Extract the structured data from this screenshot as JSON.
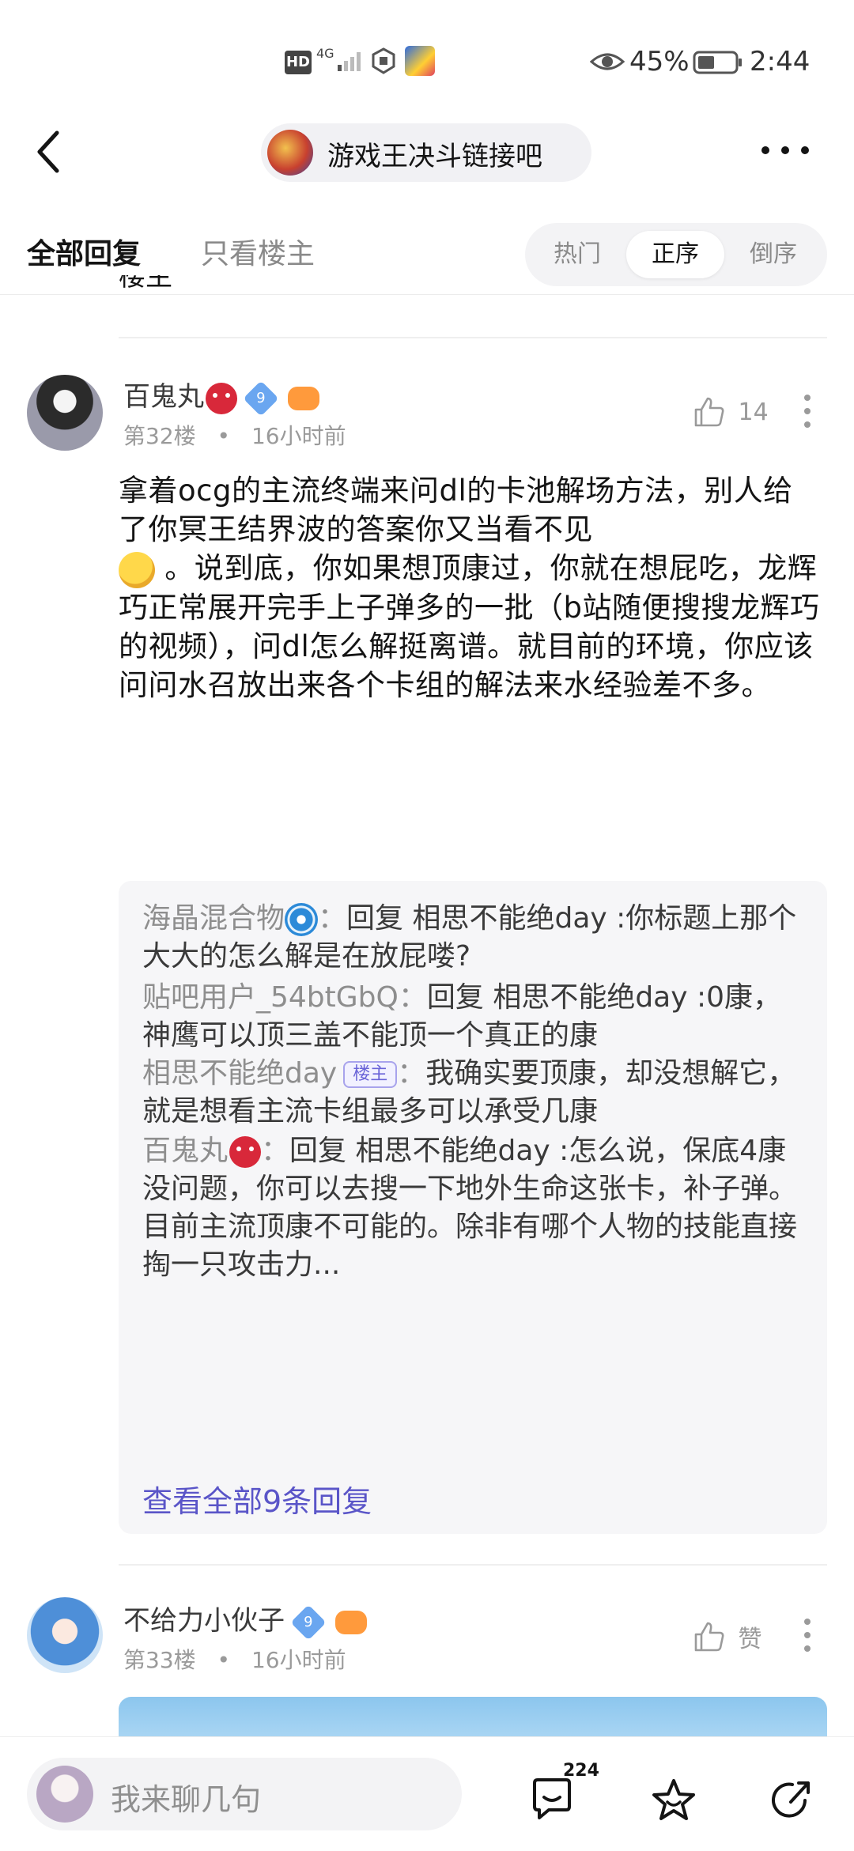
{
  "status_bar": {
    "hd": "HD",
    "network": "4G",
    "battery_pct": "45%",
    "time": "2:44"
  },
  "header": {
    "forum_name": "游戏王决斗链接吧"
  },
  "tabs": {
    "all": "全部回复",
    "owner_only": "只看楼主"
  },
  "sort": {
    "hot": "热门",
    "asc": "正序",
    "desc": "倒序",
    "selected": "正序"
  },
  "prev_tail": "楼主",
  "post32": {
    "username": "百鬼丸",
    "level": "9",
    "floor": "第32楼",
    "dot": "•",
    "time": "16小时前",
    "likes": "14",
    "body_a": "拿着ocg的主流终端来问dl的卡池解场方法，别人给了你冥王结界波的答案你又当看不见",
    "body_b": " 。说到底，你如果想顶康过，你就在想屁吃，龙辉巧正常展开完手上子弹多的一批（b站随便搜搜龙辉巧的视频），问dl怎么解挺离谱。就目前的环境，你应该问问水召放出来各个卡组的解法来水经验差不多。",
    "replies": [
      {
        "name": "海晶混合物",
        "sep": "：",
        "text": "回复  相思不能绝day :你标题上那个大大的怎么解是在放屁喽?"
      },
      {
        "name": "贴吧用户_54btGbQ",
        "sep": "：",
        "text": "回复  相思不能绝day :0康，神鹰可以顶三盖不能顶一个真正的康"
      },
      {
        "name": "相思不能绝day",
        "tag": "楼主",
        "sep": "：",
        "text": "我确实要顶康，却没想解它，就是想看主流卡组最多可以承受几康"
      },
      {
        "name": "百鬼丸",
        "sep": "：",
        "text": "回复 相思不能绝day :怎么说，保底4康没问题，你可以去搜一下地外生命这张卡，补子弹。目前主流顶康不可能的。除非有哪个人物的技能直接掏一只攻击力..."
      }
    ],
    "view_all": "查看全部9条回复"
  },
  "post33": {
    "username": "不给力小伙子",
    "level": "9",
    "floor": "第33楼",
    "dot": "•",
    "time": "16小时前",
    "like_label": "赞"
  },
  "bottom_bar": {
    "input_placeholder": "我来聊几句",
    "comment_count": "224"
  }
}
